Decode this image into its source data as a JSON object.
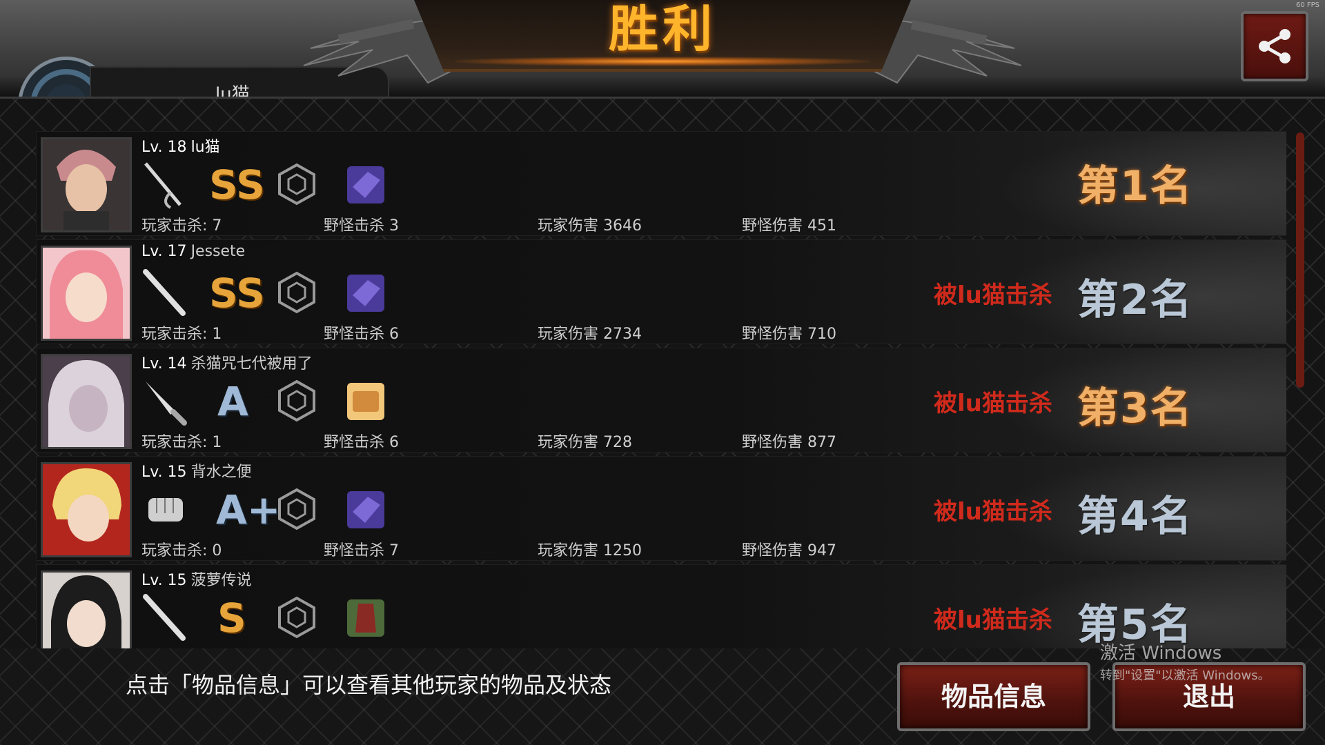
{
  "title": "胜利",
  "fps": "60 FPS",
  "header": {
    "player_name_partial": "lu猫"
  },
  "hint": "点击「物品信息」可以查看其他玩家的物品及状态",
  "buttons": {
    "item_info": "物品信息",
    "exit": "退出"
  },
  "watermark": {
    "line1": "激活 Windows",
    "line2": "转到\"设置\"以激活 Windows。"
  },
  "labels": {
    "player_kills": "玩家击杀: ",
    "monster_kills": "野怪击杀 ",
    "player_damage": "玩家伤害 ",
    "monster_damage": "野怪伤害 "
  },
  "players": [
    {
      "level": "Lv. 18",
      "name": "lu猫",
      "weapon": "rapier-icon",
      "grade": "SS",
      "player_kills": "7",
      "monster_kills": "3",
      "player_damage": "3646",
      "monster_damage": "451",
      "killed_by": "",
      "rank": "第1名",
      "rank_color": "#f0b068"
    },
    {
      "level": "Lv. 17",
      "name": "Jessete",
      "weapon": "bat-icon",
      "grade": "SS",
      "player_kills": "1",
      "monster_kills": "6",
      "player_damage": "2734",
      "monster_damage": "710",
      "killed_by": "被lu猫击杀",
      "rank": "第2名",
      "rank_color": "#b9c7d6"
    },
    {
      "level": "Lv. 14",
      "name": "杀猫咒七代被用了",
      "weapon": "knife-icon",
      "grade": "A",
      "player_kills": "1",
      "monster_kills": "6",
      "player_damage": "728",
      "monster_damage": "877",
      "killed_by": "被lu猫击杀",
      "rank": "第3名",
      "rank_color": "#f0b068"
    },
    {
      "level": "Lv. 15",
      "name": "背水之便",
      "weapon": "fist-icon",
      "grade": "A+",
      "player_kills": "0",
      "monster_kills": "7",
      "player_damage": "1250",
      "monster_damage": "947",
      "killed_by": "被lu猫击杀",
      "rank": "第4名",
      "rank_color": "#b9c7d6"
    },
    {
      "level": "Lv. 15",
      "name": "菠萝传说",
      "weapon": "bat-icon",
      "grade": "S",
      "player_kills": "",
      "monster_kills": "",
      "player_damage": "",
      "monster_damage": "",
      "killed_by": "被lu猫击杀",
      "rank": "第5名",
      "rank_color": "#b9c7d6"
    }
  ]
}
